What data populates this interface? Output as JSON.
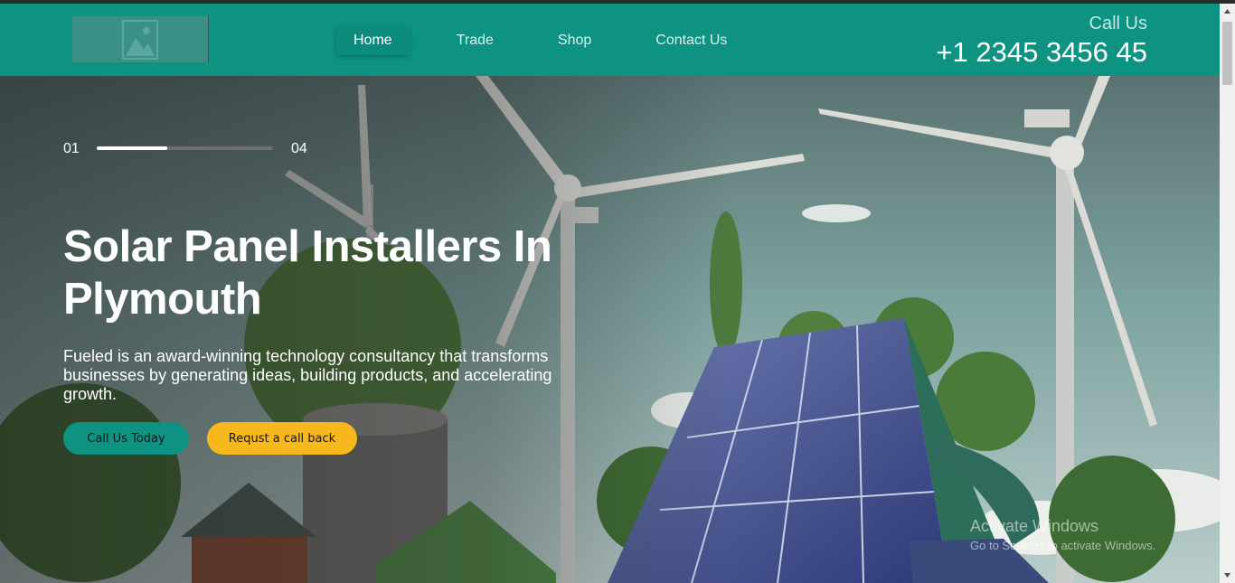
{
  "nav": {
    "logo_icon": "image-placeholder-icon",
    "links": [
      {
        "label": "Home",
        "active": true
      },
      {
        "label": "Trade",
        "active": false
      },
      {
        "label": "Shop",
        "active": false
      },
      {
        "label": "Contact Us",
        "active": false
      }
    ],
    "call_label": "Call Us",
    "phone": "+1 2345 3456 45"
  },
  "hero": {
    "slide_current": "01",
    "slide_total": "04",
    "progress": 0.4,
    "title": "Solar Panel Installers In Plymouth",
    "description": "Fueled is an award-winning technology consultancy that transforms businesses by generating ideas, building products, and accelerating growth.",
    "primary_button": "Call Us Today",
    "secondary_button": "Requst a call back"
  },
  "watermark": {
    "title": "Activate Windows",
    "subtitle": "Go to Settings to activate Windows."
  },
  "colors": {
    "brand_teal": "#0e9383",
    "accent_yellow": "#f7b81d"
  }
}
